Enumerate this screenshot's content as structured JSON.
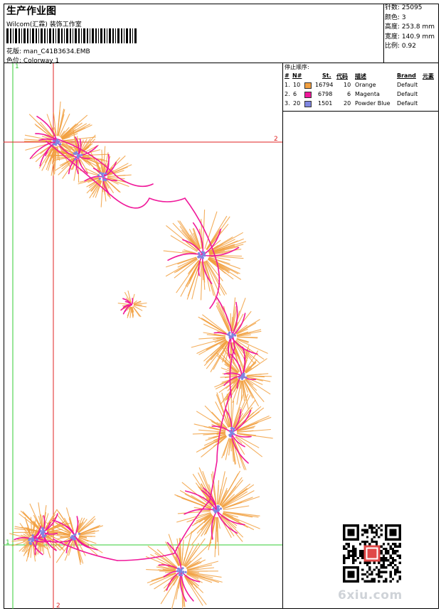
{
  "header": {
    "title": "生产作业图",
    "subtitle": "Wilcom(汇霖) 装饰工作室",
    "design_label": "花版:",
    "design_value": "man_C41B3634.EMB",
    "colorway_label": "色位:",
    "colorway_value": "Colorway 1"
  },
  "stats": {
    "stitches": "针数: 25095",
    "colors": "颜色: 3",
    "height": "高度: 253.8 mm",
    "width": "宽度: 140.9 mm",
    "scale": "比例: 0.92"
  },
  "stop_sequence": {
    "title": "停止顺序:",
    "headers": {
      "num": "#",
      "n": "N#",
      "st": "St.",
      "code": "代码",
      "desc": "描述",
      "brand": "Brand",
      "element": "元素"
    },
    "rows": [
      {
        "num": "1.",
        "n": "10",
        "color": "#f2a040",
        "st": "16794",
        "code": "10",
        "desc": "Orange",
        "brand": "Default"
      },
      {
        "num": "2.",
        "n": "6",
        "color": "#f0189a",
        "st": "6798",
        "code": "6",
        "desc": "Magenta",
        "brand": "Default"
      },
      {
        "num": "3.",
        "n": "20",
        "color": "#7f86e0",
        "st": "1501",
        "code": "20",
        "desc": "Powder Blue",
        "brand": "Default"
      }
    ]
  },
  "guides": {
    "v_green": "1",
    "v_red": "2",
    "h_red": "2",
    "h_green": "1"
  },
  "colors": {
    "orange": "#f2a040",
    "magenta": "#f0189a",
    "blue": "#7f86e0",
    "green": "#33cc33",
    "red": "#e02020"
  },
  "watermark": "6xiu.com"
}
